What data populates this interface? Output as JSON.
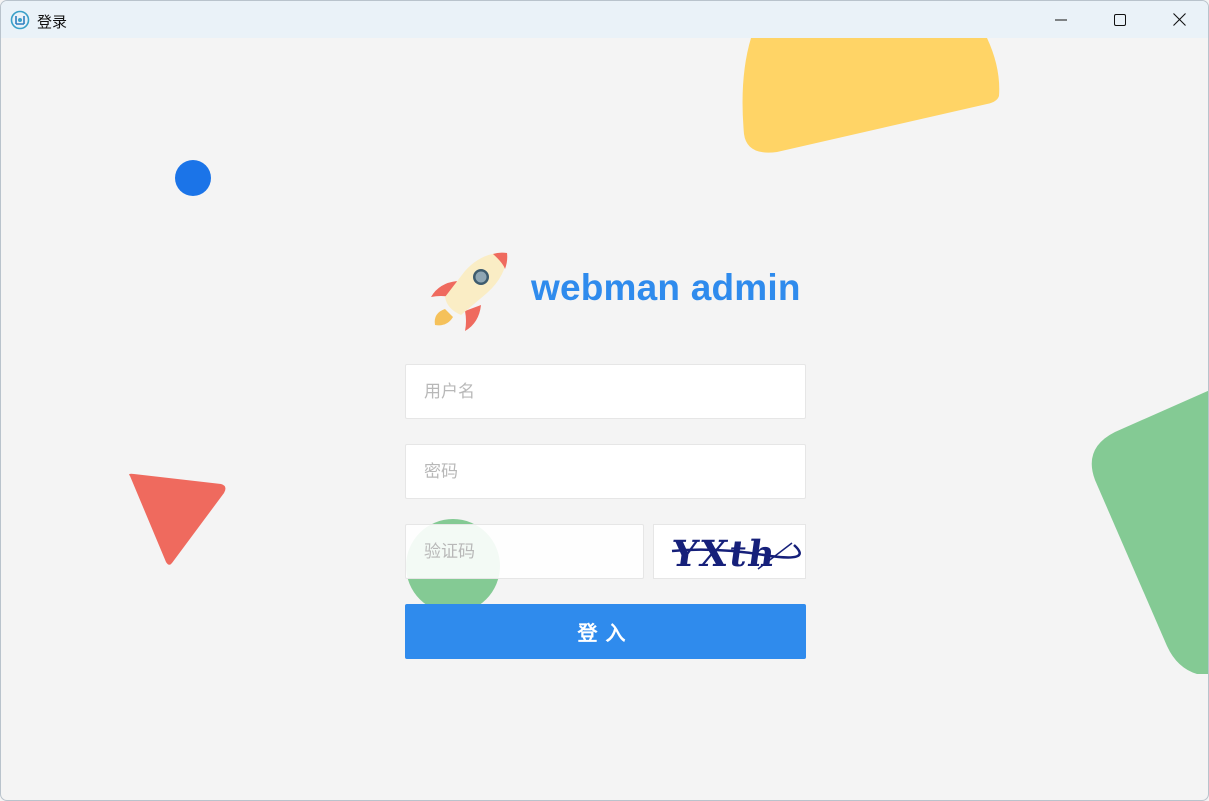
{
  "window": {
    "title": "登录",
    "app_icon": "app-logo-icon",
    "controls": {
      "minimize": "minimize-icon",
      "maximize": "maximize-icon",
      "close": "close-icon"
    }
  },
  "login": {
    "brand": "webman admin",
    "logo_icon": "rocket-icon",
    "username_placeholder": "用户名",
    "password_placeholder": "密码",
    "captcha_placeholder": "验证码",
    "captcha_text": "YXth",
    "submit_label": "登入"
  },
  "colors": {
    "accent": "#2f8bed",
    "shape_yellow": "#ffd466",
    "shape_green": "#84ca94",
    "shape_red": "#ef6a5e",
    "shape_blue": "#1b74e8",
    "captcha_ink": "#16207a"
  }
}
